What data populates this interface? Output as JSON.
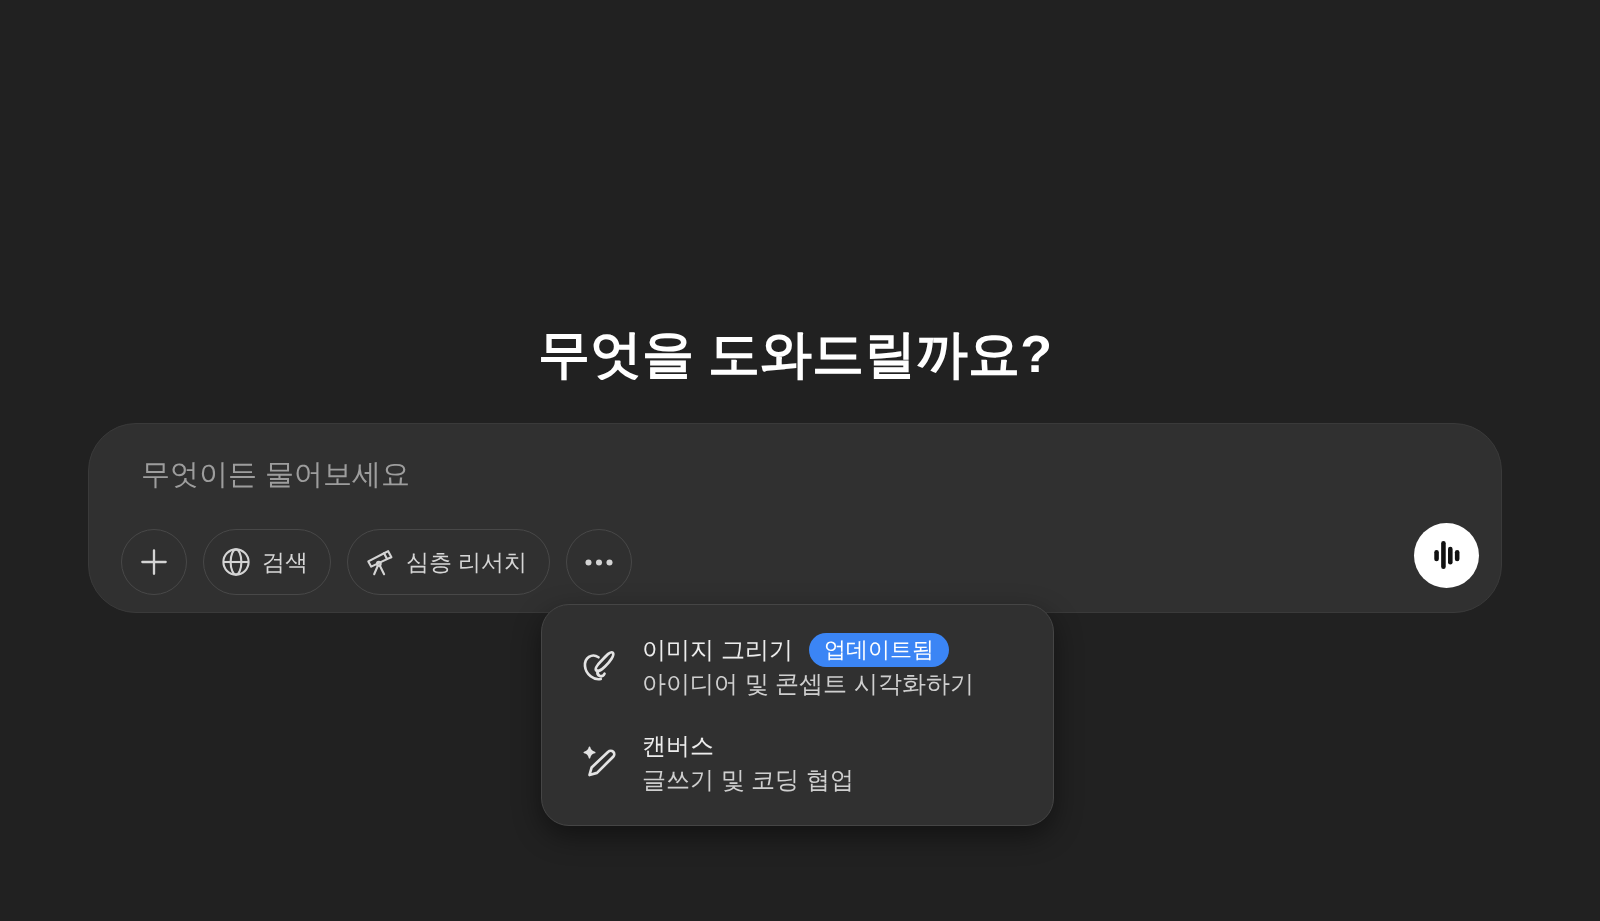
{
  "heading": "무엇을 도와드릴까요?",
  "composer": {
    "placeholder": "무엇이든 물어보세요",
    "tools": [
      {
        "kind": "attach"
      },
      {
        "kind": "search",
        "label": "검색"
      },
      {
        "kind": "research",
        "label": "심층 리서치"
      },
      {
        "kind": "more"
      }
    ]
  },
  "menu": {
    "items": [
      {
        "kind": "image",
        "title": "이미지 그리기",
        "badge": "업데이트됨",
        "description": "아이디어 및 콘셉트 시각화하기"
      },
      {
        "kind": "canvas",
        "title": "캔버스",
        "description": "글쓰기 및 코딩 협업"
      }
    ]
  }
}
